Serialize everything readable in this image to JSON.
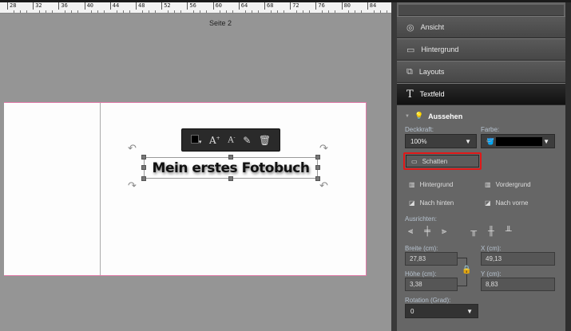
{
  "ruler": {
    "ticks": [
      "28",
      "32",
      "36",
      "40",
      "44",
      "48",
      "52",
      "56",
      "60",
      "64",
      "68",
      "72",
      "76",
      "80",
      "84"
    ]
  },
  "canvas": {
    "page_label": "Seite 2",
    "text": "Mein erstes Fotobuch"
  },
  "panel": {
    "sections": [
      {
        "label": "Ansicht",
        "icon": "eye-icon"
      },
      {
        "label": "Hintergrund",
        "icon": "background-icon"
      },
      {
        "label": "Layouts",
        "icon": "layouts-icon"
      },
      {
        "label": "Textfeld",
        "icon": "text-icon",
        "active": true
      }
    ],
    "aussehen": "Aussehen",
    "deckkraft_label": "Deckkraft:",
    "deckkraft_value": "100%",
    "farbe_label": "Farbe:",
    "farbe_value": "#000000",
    "schatten": "Schatten",
    "hintergrund": "Hintergrund",
    "vordergrund": "Vordergrund",
    "nach_hinten": "Nach hinten",
    "nach_vorne": "Nach vorne",
    "ausrichten": "Ausrichten:",
    "breite_label": "Breite (cm):",
    "breite": "27,83",
    "x_label": "X (cm):",
    "x": "49,13",
    "hoehe_label": "Höhe (cm):",
    "hoehe": "3,38",
    "y_label": "Y (cm):",
    "y": "8,83",
    "rotation_label": "Rotation (Grad):",
    "rotation": "0"
  },
  "colors": {
    "highlight": "#e01818",
    "text_color": "#000000"
  }
}
